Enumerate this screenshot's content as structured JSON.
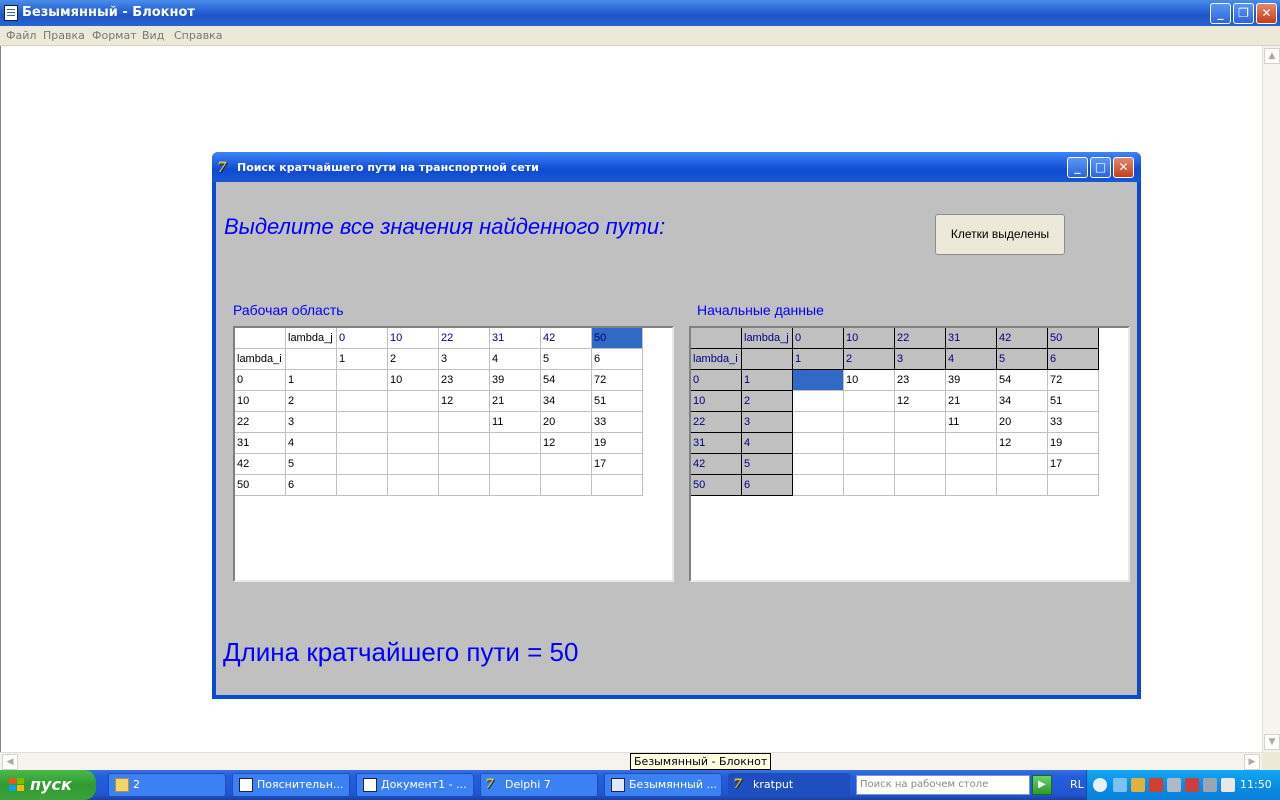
{
  "notepad": {
    "title": "Безымянный - Блокнот",
    "menu": [
      "Файл",
      "Правка",
      "Формат",
      "Вид",
      "Справка"
    ]
  },
  "dialog": {
    "title": "Поиск кратчайшего пути на транспортной сети",
    "prompt": "Выделите все значения найденного пути:",
    "done_button": "Клетки выделены",
    "work_label": "Рабочая область",
    "data_label": "Начальные данные",
    "result": "Длина кратчайшего пути = 50",
    "work_grid": [
      [
        "",
        "lambda_j",
        "0",
        "10",
        "22",
        "31",
        "42",
        "50"
      ],
      [
        "lambda_i",
        "",
        "1",
        "2",
        "3",
        "4",
        "5",
        "6"
      ],
      [
        "0",
        "1",
        "",
        "10",
        "23",
        "39",
        "54",
        "72"
      ],
      [
        "10",
        "2",
        "",
        "",
        "12",
        "21",
        "34",
        "51"
      ],
      [
        "22",
        "3",
        "",
        "",
        "",
        "11",
        "20",
        "33"
      ],
      [
        "31",
        "4",
        "",
        "",
        "",
        "",
        "12",
        "19"
      ],
      [
        "42",
        "5",
        "",
        "",
        "",
        "",
        "",
        "17"
      ],
      [
        "50",
        "6",
        "",
        "",
        "",
        "",
        "",
        ""
      ]
    ],
    "data_grid": [
      [
        "",
        "lambda_j",
        "0",
        "10",
        "22",
        "31",
        "42",
        "50"
      ],
      [
        "lambda_i",
        "",
        "1",
        "2",
        "3",
        "4",
        "5",
        "6"
      ],
      [
        "0",
        "1",
        "",
        "10",
        "23",
        "39",
        "54",
        "72"
      ],
      [
        "10",
        "2",
        "",
        "",
        "12",
        "21",
        "34",
        "51"
      ],
      [
        "22",
        "3",
        "",
        "",
        "",
        "11",
        "20",
        "33"
      ],
      [
        "31",
        "4",
        "",
        "",
        "",
        "",
        "12",
        "19"
      ],
      [
        "42",
        "5",
        "",
        "",
        "",
        "",
        "",
        "17"
      ],
      [
        "50",
        "6",
        "",
        "",
        "",
        "",
        "",
        ""
      ]
    ],
    "work_selected_cell": [
      0,
      7
    ],
    "data_selected_cell": [
      2,
      2
    ]
  },
  "taskbar": {
    "start_label": "пуск",
    "tasks": [
      {
        "label": "2",
        "icon": "folder-icon",
        "active": false
      },
      {
        "label": "Пояснительн...",
        "icon": "word-icon",
        "active": false
      },
      {
        "label": "Документ1 - ...",
        "icon": "word-icon",
        "active": false
      },
      {
        "label": "Delphi 7",
        "icon": "delphi-icon",
        "active": false
      },
      {
        "label": "Безымянный ...",
        "icon": "notepad-icon",
        "active": false
      },
      {
        "label": "kratput",
        "icon": "delphi-icon",
        "active": true
      }
    ],
    "search_placeholder": "Поиск на рабочем столе",
    "language": "RL",
    "clock": "11:50"
  },
  "tooltip": "Безымянный - Блокнот",
  "colors": {
    "accent_text": "#0000ff",
    "selection": "#316ac5",
    "form_bg": "#c0c0c0"
  }
}
